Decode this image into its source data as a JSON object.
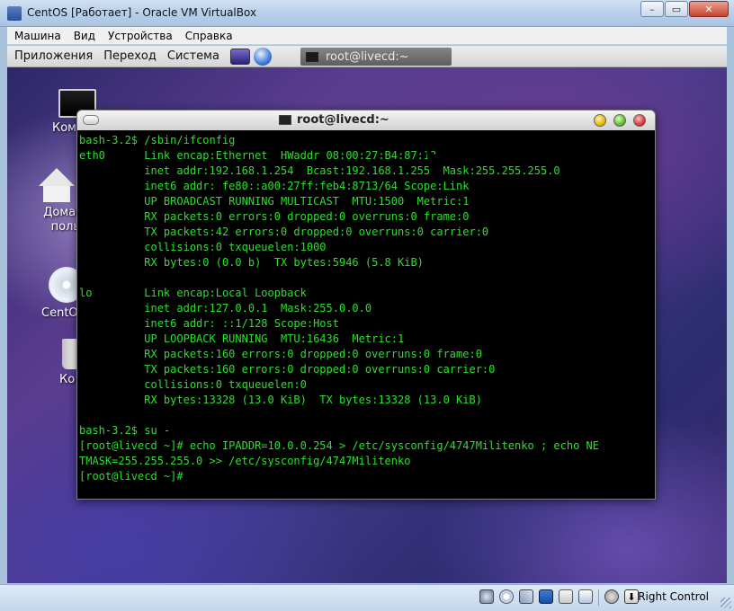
{
  "host": {
    "window_title": "CentOS [Работает] - Oracle VM VirtualBox",
    "controls": {
      "minimize": "–",
      "maximize": "▭",
      "close": "✕"
    },
    "menu": [
      "Машина",
      "Вид",
      "Устройства",
      "Справка"
    ],
    "status_host_key": "Right Control",
    "status_icons": [
      "hdd-icon",
      "cd-icon",
      "usb-icon",
      "network-icon",
      "shared-folders-icon",
      "display-icon",
      "mouse-integration-icon",
      "host-key-icon"
    ]
  },
  "guest": {
    "panel_menu": [
      "Приложения",
      "Переход",
      "Система"
    ],
    "taskbar_button": "root@livecd:~",
    "desktop_icons": [
      {
        "label": "Ком",
        "icon": "computer-icon"
      },
      {
        "label": "Домаш\nпольз\nс",
        "icon": "home-folder-icon"
      },
      {
        "label": "CentO",
        "icon": "disc-icon"
      },
      {
        "label": "Ко",
        "icon": "trash-icon"
      }
    ]
  },
  "terminal": {
    "title": "root@livecd:~",
    "lines": [
      "bash-3.2$ /sbin/ifconfig",
      "eth0      Link encap:Ethernet  HWaddr 08:00:27:B4:87:13",
      "          inet addr:192.168.1.254  Bcast:192.168.1.255  Mask:255.255.255.0",
      "          inet6 addr: fe80::a00:27ff:feb4:8713/64 Scope:Link",
      "          UP BROADCAST RUNNING MULTICAST  MTU:1500  Metric:1",
      "          RX packets:0 errors:0 dropped:0 overruns:0 frame:0",
      "          TX packets:42 errors:0 dropped:0 overruns:0 carrier:0",
      "          collisions:0 txqueuelen:1000",
      "          RX bytes:0 (0.0 b)  TX bytes:5946 (5.8 KiB)",
      "",
      "lo        Link encap:Local Loopback",
      "          inet addr:127.0.0.1  Mask:255.0.0.0",
      "          inet6 addr: ::1/128 Scope:Host",
      "          UP LOOPBACK RUNNING  MTU:16436  Metric:1",
      "          RX packets:160 errors:0 dropped:0 overruns:0 frame:0",
      "          TX packets:160 errors:0 dropped:0 overruns:0 carrier:0",
      "          collisions:0 txqueuelen:0",
      "          RX bytes:13328 (13.0 KiB)  TX bytes:13328 (13.0 KiB)",
      "",
      "bash-3.2$ su -",
      "[root@livecd ~]# echo IPADDR=10.0.0.254 > /etc/sysconfig/4747Militenko ; echo NE",
      "TMASK=255.255.255.0 >> /etc/sysconfig/4747Militenko",
      "[root@livecd ~]#"
    ]
  }
}
